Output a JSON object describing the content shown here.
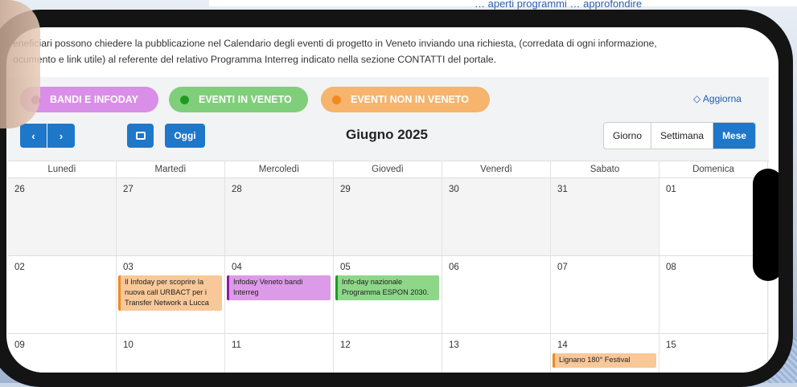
{
  "page_header_fragment": "… aperti programmi … approfondire",
  "intro": {
    "line1": "eneficiari possono chiedere la pubblicazione nel Calendario degli eventi di progetto in Veneto inviando una richiesta, (corredata di ogni informazione,",
    "line2": "ocumento e link utile) al referente del relativo Programma Interreg indicato nella sezione CONTATTI del portale."
  },
  "legend": [
    {
      "label": "BANDI E INFODAY",
      "color": "#8e1aa6"
    },
    {
      "label": "EVENTI IN VENETO",
      "color": "#1e9a22"
    },
    {
      "label": "EVENTI NON IN VENETO",
      "color": "#ef8a1e"
    }
  ],
  "toolbar": {
    "refresh_label": "Aggiorna",
    "prev_glyph": "‹",
    "next_glyph": "›",
    "today_label": "Oggi",
    "month_title": "Giugno 2025",
    "views": [
      "Giorno",
      "Settimana",
      "Mese"
    ],
    "active_view": "Mese"
  },
  "calendar": {
    "weekdays": [
      "Lunedì",
      "Martedì",
      "Mercoledì",
      "Giovedì",
      "Venerdì",
      "Sabato",
      "Domenica"
    ],
    "weeks": [
      {
        "days": [
          {
            "num": "26",
            "other": true
          },
          {
            "num": "27",
            "other": true
          },
          {
            "num": "28",
            "other": true
          },
          {
            "num": "29",
            "other": true
          },
          {
            "num": "30",
            "other": true
          },
          {
            "num": "31",
            "other": true
          },
          {
            "num": "01",
            "other": false
          }
        ]
      },
      {
        "days": [
          {
            "num": "02",
            "other": false
          },
          {
            "num": "03",
            "other": false,
            "event": {
              "text": "Il Infoday per scoprire la nuova call URBACT per i Transfer Network a Lucca",
              "kind": "orange"
            }
          },
          {
            "num": "04",
            "other": false,
            "event": {
              "text": "Infoday Veneto bandi Interreg",
              "kind": "purple"
            }
          },
          {
            "num": "05",
            "other": false,
            "event": {
              "text": "Info-day nazionale Programma ESPON 2030.",
              "kind": "green"
            }
          },
          {
            "num": "06",
            "other": false
          },
          {
            "num": "07",
            "other": false
          },
          {
            "num": "08",
            "other": false
          }
        ]
      },
      {
        "days": [
          {
            "num": "09",
            "other": false
          },
          {
            "num": "10",
            "other": false
          },
          {
            "num": "11",
            "other": false
          },
          {
            "num": "12",
            "other": false
          },
          {
            "num": "13",
            "other": false
          },
          {
            "num": "14",
            "other": false,
            "event": {
              "text": "Lignano 180° Festival",
              "kind": "orange"
            }
          },
          {
            "num": "15",
            "other": false
          }
        ]
      }
    ]
  }
}
